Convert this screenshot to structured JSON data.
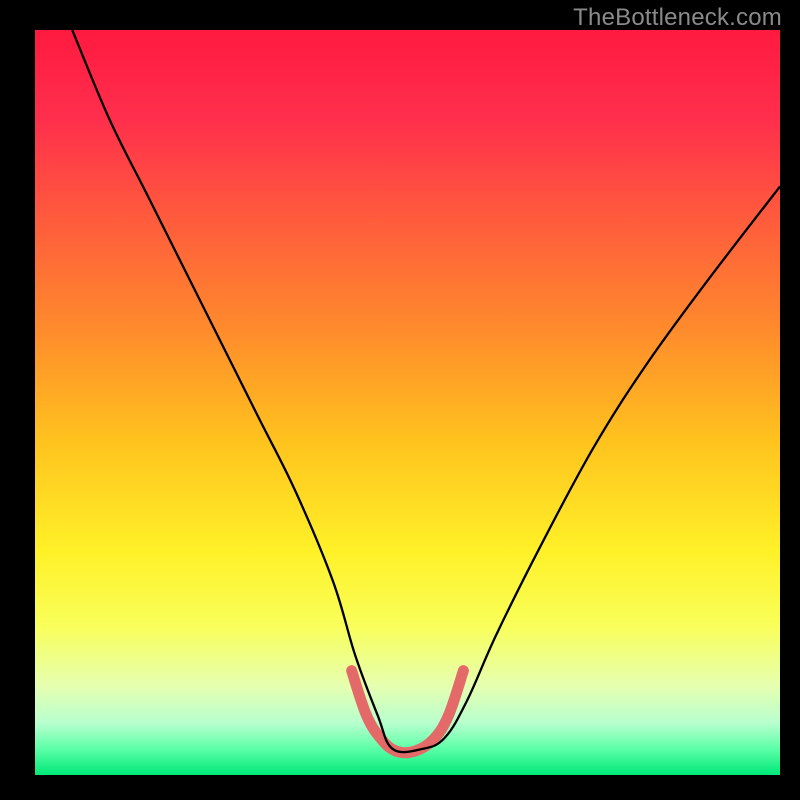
{
  "watermark": "TheBottleneck.com",
  "chart_data": {
    "type": "line",
    "title": "",
    "xlabel": "",
    "ylabel": "",
    "xlim": [
      0,
      100
    ],
    "ylim": [
      0,
      100
    ],
    "grid": false,
    "legend": false,
    "gradient_stops": [
      {
        "offset": 0.0,
        "color": "#ff1a3f"
      },
      {
        "offset": 0.12,
        "color": "#ff2f4c"
      },
      {
        "offset": 0.25,
        "color": "#ff5a3d"
      },
      {
        "offset": 0.4,
        "color": "#ff8a2c"
      },
      {
        "offset": 0.55,
        "color": "#ffc21e"
      },
      {
        "offset": 0.7,
        "color": "#fff128"
      },
      {
        "offset": 0.8,
        "color": "#f9ff5a"
      },
      {
        "offset": 0.88,
        "color": "#e6ffb0"
      },
      {
        "offset": 0.93,
        "color": "#b8ffce"
      },
      {
        "offset": 0.965,
        "color": "#5cffa7"
      },
      {
        "offset": 1.0,
        "color": "#00e878"
      }
    ],
    "series": [
      {
        "name": "bottleneck-curve",
        "stroke": "#000000",
        "stroke_width": 2.3,
        "x": [
          5,
          10,
          15,
          20,
          25,
          30,
          35,
          40,
          43,
          46,
          48,
          52,
          55,
          58,
          62,
          68,
          75,
          82,
          90,
          100
        ],
        "y": [
          100,
          88,
          78,
          68,
          58,
          48,
          38,
          26,
          16,
          8,
          3.5,
          3.5,
          5,
          10,
          19,
          31,
          44,
          55,
          66,
          79
        ]
      },
      {
        "name": "valley-highlight",
        "stroke": "#e46a6a",
        "stroke_width": 11,
        "linecap": "round",
        "x": [
          42.5,
          44.5,
          46.5,
          48.5,
          51.0,
          53.5,
          55.5,
          57.5
        ],
        "y": [
          14.0,
          8.0,
          4.8,
          3.2,
          3.2,
          4.8,
          8.0,
          14.0
        ]
      }
    ]
  }
}
